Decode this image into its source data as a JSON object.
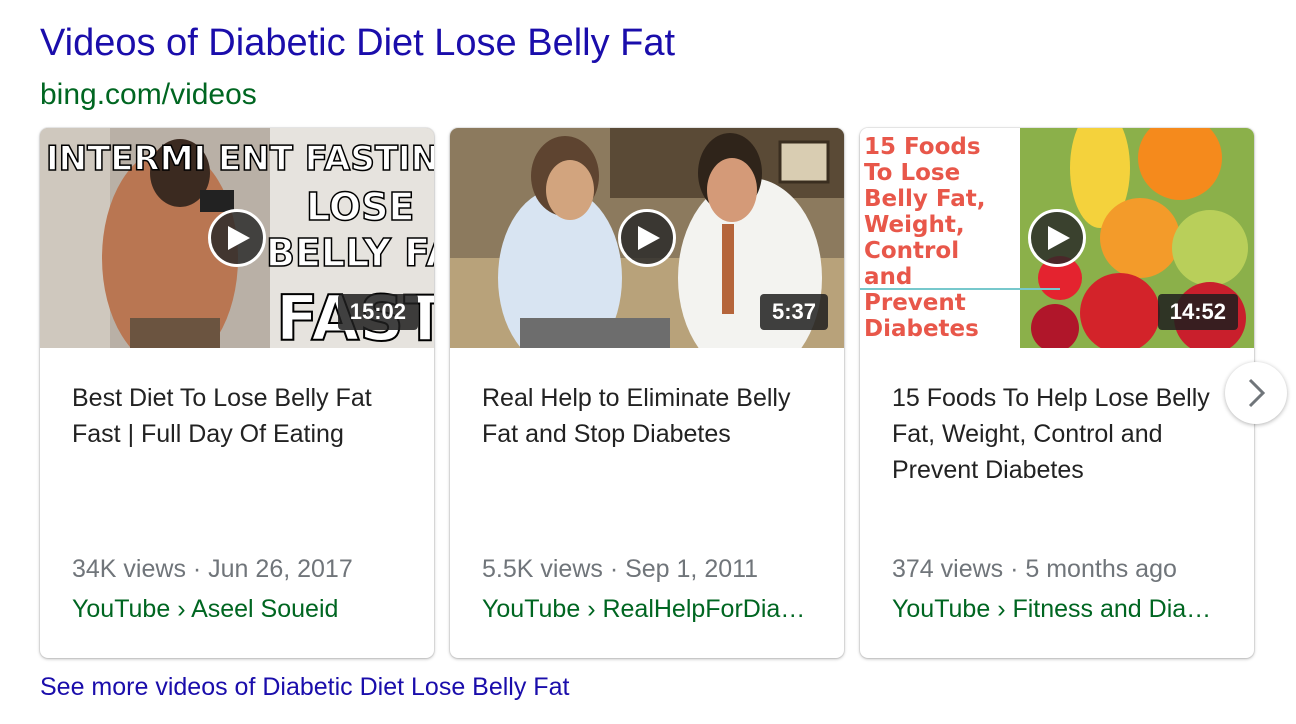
{
  "header": {
    "title": "Videos of Diabetic Diet Lose Belly Fat",
    "source": "bing.com/videos"
  },
  "videos": [
    {
      "title": "Best Diet To Lose Belly Fat Fast | Full Day Of Eating",
      "duration": "15:02",
      "meta": "34K views · Jun 26, 2017",
      "channel": "YouTube › Aseel Soueid",
      "thumb_lines": [
        "INTERMI  ENT FASTING",
        "LOSE",
        "BELLY FAT",
        "FAST"
      ]
    },
    {
      "title": "Real Help to Eliminate Belly Fat and Stop Diabetes",
      "duration": "5:37",
      "meta": "5.5K views · Sep 1, 2011",
      "channel": "YouTube › RealHelpForDia…"
    },
    {
      "title": "15 Foods To Help Lose Belly Fat, Weight, Control and Prevent Diabetes",
      "duration": "14:52",
      "meta": "374 views · 5 months ago",
      "channel": "YouTube › Fitness and Dia…",
      "thumb_lines": [
        "15 Foods",
        "To Lose",
        "Belly Fat,",
        "Weight,",
        "Control",
        "and",
        "Prevent",
        "Diabetes"
      ]
    }
  ],
  "carousel": {
    "next_icon": "chevron-right-icon"
  },
  "footer": {
    "more_link": "See more videos of Diabetic Diet Lose Belly Fat"
  },
  "colors": {
    "link_blue": "#1a0dab",
    "url_green": "#006621",
    "meta_gray": "#70757a",
    "thumb3_text": "#e8574a"
  }
}
